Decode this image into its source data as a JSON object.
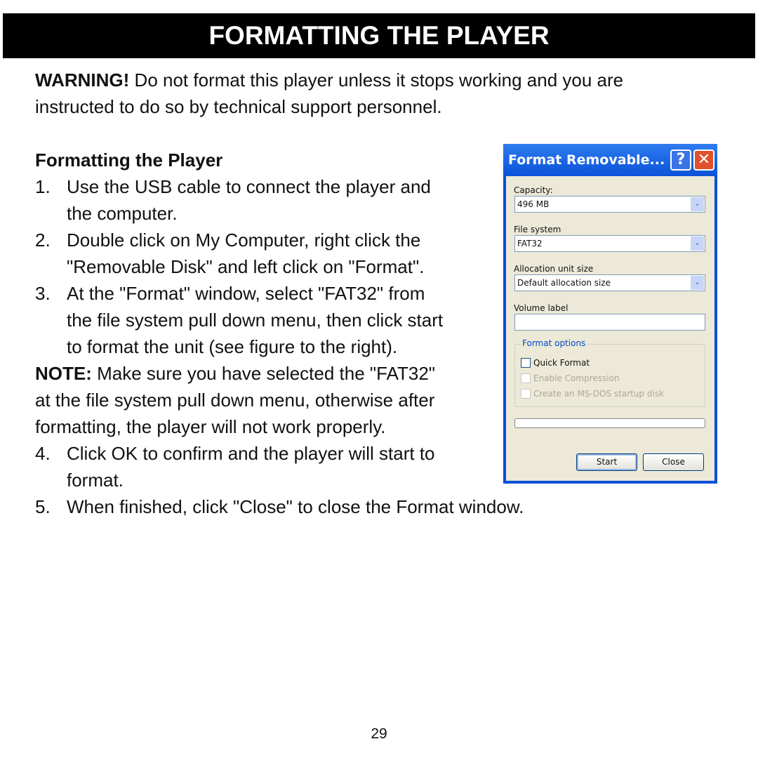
{
  "banner": "FORMATTING THE PLAYER",
  "warning": {
    "label": "WARNING!",
    "lines": [
      " Do not format this player unless it stops working and you are",
      "instructed to do so by technical support personnel."
    ]
  },
  "heading": "Formatting the Player",
  "steps": [
    {
      "num": "1.",
      "lines": [
        "Use the USB cable to connect the player and",
        "the computer."
      ]
    },
    {
      "num": "2.",
      "lines": [
        "Double click on My Computer, right click the",
        "\"Removable Disk\" and left click on \"Format\"."
      ]
    },
    {
      "num": "3.",
      "lines": [
        "At the \"Format\" window, select \"FAT32\" from",
        "the file system pull down menu, then click start",
        "to format the unit (see figure to the right)."
      ]
    },
    {
      "num": "4.",
      "lines": [
        "Click OK to confirm and the player will start to",
        "format."
      ]
    },
    {
      "num": "5.",
      "lines": [
        "When finished, click \"Close\" to close the Format window."
      ]
    }
  ],
  "note": {
    "label": "NOTE:",
    "lines": [
      " Make sure you have selected the \"FAT32\"",
      "at the file system pull down menu, otherwise after",
      "formatting, the player will not work properly."
    ]
  },
  "dialog": {
    "title": "Format Removable...",
    "help": "?",
    "close": "✕",
    "capacity_label": "Capacity:",
    "capacity_value": "496 MB",
    "fs_label": "File system",
    "fs_value": "FAT32",
    "alloc_label": "Allocation unit size",
    "alloc_value": "Default allocation size",
    "volume_label": "Volume label",
    "volume_value": "",
    "options_label": "Format options",
    "quick": "Quick Format",
    "compression": "Enable Compression",
    "msdos": "Create an MS-DOS startup disk",
    "progress": 0,
    "start": "Start",
    "close_btn": "Close",
    "arrow": "⌄"
  },
  "page_number": "29"
}
